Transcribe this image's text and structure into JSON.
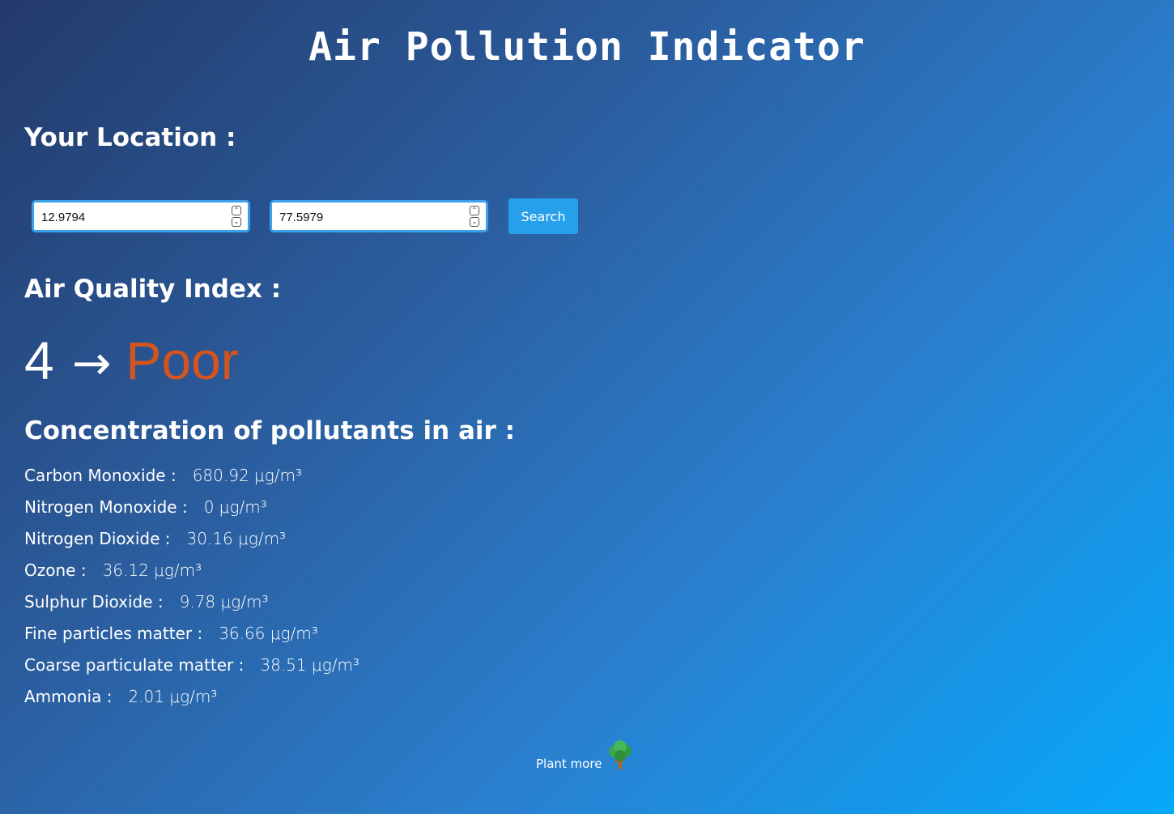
{
  "header": {
    "title": "Air Pollution Indicator"
  },
  "location": {
    "heading": "Your Location :",
    "latitude_value": "12.9794",
    "longitude_value": "77.5979",
    "search_label": "Search"
  },
  "aqi": {
    "heading": "Air Quality Index :",
    "value": "4",
    "arrow": "→",
    "label": "Poor",
    "label_color": "#d4541d"
  },
  "pollutants": {
    "heading": "Concentration of pollutants in air :",
    "items": [
      {
        "name": "Carbon Monoxide :",
        "value": "680.92 μg/m³"
      },
      {
        "name": "Nitrogen Monoxide :",
        "value": "0 μg/m³"
      },
      {
        "name": "Nitrogen Dioxide :",
        "value": "30.16 μg/m³"
      },
      {
        "name": "Ozone :",
        "value": "36.12 μg/m³"
      },
      {
        "name": "Sulphur Dioxide :",
        "value": "9.78 μg/m³"
      },
      {
        "name": "Fine particles matter :",
        "value": "36.66 μg/m³"
      },
      {
        "name": "Coarse particulate matter :",
        "value": "38.51 μg/m³"
      },
      {
        "name": "Ammonia :",
        "value": "2.01 μg/m³"
      }
    ]
  },
  "footer": {
    "text": "Plant more",
    "icon": "tree-icon"
  }
}
